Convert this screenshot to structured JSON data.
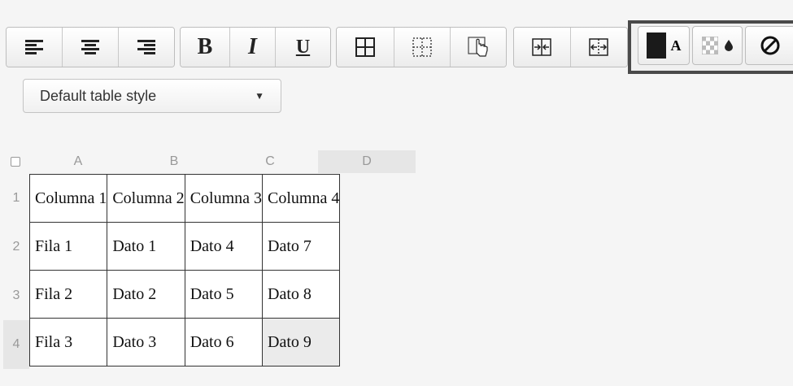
{
  "toolbar": {
    "align_group": [
      "align-left",
      "align-center",
      "align-right"
    ],
    "format_group": {
      "bold": "B",
      "italic": "I",
      "underline": "U"
    },
    "border_group": [
      "borders-all",
      "borders-inner-dashed",
      "select-cell-hand"
    ],
    "merge_group": [
      "merge-cells",
      "split-cells"
    ],
    "color_group": {
      "text_color_label": "A",
      "text_color": "#1a1a1a",
      "bg_color_icon": "checker-drop",
      "clear_icon": "no-format"
    }
  },
  "style_select": {
    "value": "Default table style"
  },
  "sheet": {
    "columns": [
      "A",
      "B",
      "C",
      "D"
    ],
    "rows": [
      "1",
      "2",
      "3",
      "4"
    ],
    "selected_column": "D",
    "selected_row": "4",
    "cells": [
      [
        "Columna 1",
        "Columna 2",
        "Columna 3",
        "Columna 4"
      ],
      [
        "Fila 1",
        "Dato 1",
        "Dato 4",
        "Dato 7"
      ],
      [
        "Fila 2",
        "Dato 2",
        "Dato 5",
        "Dato 8"
      ],
      [
        "Fila 3",
        "Dato 3",
        "Dato 6",
        "Dato 9"
      ]
    ]
  }
}
